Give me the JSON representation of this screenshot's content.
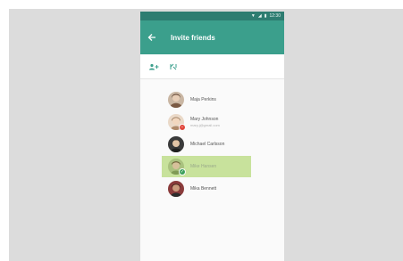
{
  "status": {
    "time": "12:30"
  },
  "appbar": {
    "title": "Invite friends"
  },
  "colors": {
    "appbar": "#3b9f8c",
    "statusbar": "#2e7d71",
    "star": "#d9283c",
    "selected": "#c8e29c",
    "badge_red": "#e0453a",
    "badge_green": "#3b9f5a"
  },
  "toolbar": {
    "icons": [
      "add-people-icon",
      "merge-icon"
    ]
  },
  "contacts": [
    {
      "name": "Maja Perkins",
      "subtitle": "",
      "starred": true,
      "selected": false,
      "badge": ""
    },
    {
      "name": "Mary Johnson",
      "subtitle": "mary.j@gmail.com",
      "starred": true,
      "selected": false,
      "badge": "remove"
    },
    {
      "name": "Michael Carlsson",
      "subtitle": "",
      "starred": false,
      "selected": false,
      "badge": ""
    },
    {
      "name": "Mike Hansen",
      "subtitle": "",
      "starred": false,
      "selected": true,
      "badge": "check"
    },
    {
      "name": "Mika Bennett",
      "subtitle": "",
      "starred": true,
      "selected": false,
      "badge": ""
    }
  ]
}
